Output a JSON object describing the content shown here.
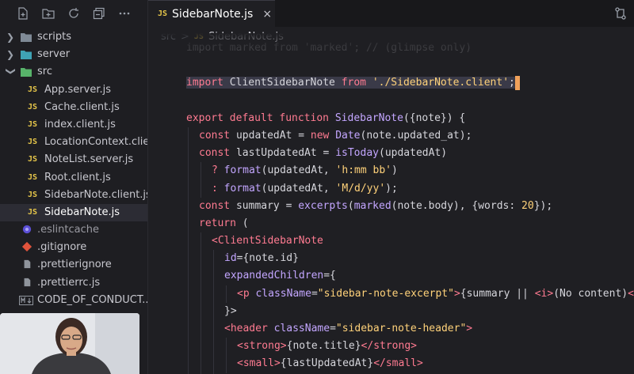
{
  "sidebar": {
    "toolbar_icons": [
      "new-file-icon",
      "new-folder-icon",
      "refresh-icon",
      "collapse-icon",
      "more-icon"
    ],
    "items": [
      {
        "label": "scripts",
        "type": "folder",
        "expanded": false,
        "level": 0
      },
      {
        "label": "server",
        "type": "folder",
        "expanded": false,
        "level": 0
      },
      {
        "label": "src",
        "type": "folder",
        "expanded": true,
        "level": 0
      },
      {
        "label": "App.server.js",
        "type": "js",
        "level": 1
      },
      {
        "label": "Cache.client.js",
        "type": "js",
        "level": 1
      },
      {
        "label": "index.client.js",
        "type": "js",
        "level": 1
      },
      {
        "label": "LocationContext.clie...",
        "type": "js",
        "level": 1
      },
      {
        "label": "NoteList.server.js",
        "type": "js",
        "level": 1
      },
      {
        "label": "Root.client.js",
        "type": "js",
        "level": 1
      },
      {
        "label": "SidebarNote.client.js",
        "type": "js",
        "level": 1
      },
      {
        "label": "SidebarNote.js",
        "type": "js",
        "level": 1,
        "active": true
      },
      {
        "label": ".eslintcache",
        "type": "dot",
        "level": 0
      },
      {
        "label": ".gitignore",
        "type": "git",
        "level": 0
      },
      {
        "label": ".prettierignore",
        "type": "file",
        "level": 0
      },
      {
        "label": ".prettierrc.js",
        "type": "file",
        "level": 0
      },
      {
        "label": "CODE_OF_CONDUCT....",
        "type": "md",
        "level": 0
      }
    ]
  },
  "tab": {
    "badge": "JS",
    "name": "SidebarNote.js",
    "close": "×"
  },
  "breadcrumb": {
    "folder": "src",
    "sep": ">",
    "badge": "JS",
    "file": "SidebarNote.js"
  },
  "colors": {
    "js_badge": "#e6c64a",
    "keyword": "#ff7b91",
    "function": "#c3a6ff",
    "string": "#ffd27a",
    "cursor": "#f0a15a"
  },
  "code_lines": [
    "import marked from 'marked'; // (glimpse only)",
    "",
    "import ClientSidebarNote from './SidebarNote.client';",
    "",
    "export default function SidebarNote({note}) {",
    "  const updatedAt = new Date(note.updated_at);",
    "  const lastUpdatedAt = isToday(updatedAt)",
    "    ? format(updatedAt, 'h:mm bb')",
    "    : format(updatedAt, 'M/d/yy');",
    "  const summary = excerpts(marked(note.body), {words: 20});",
    "  return (",
    "    <ClientSidebarNote",
    "      id={note.id}",
    "      expandedChildren={",
    "        <p className=\"sidebar-note-excerpt\">{summary || <i>(No content)</",
    "      }>",
    "      <header className=\"sidebar-note-header\">",
    "        <strong>{note.title}</strong>",
    "        <small>{lastUpdatedAt}</small>",
    "      </header>"
  ]
}
